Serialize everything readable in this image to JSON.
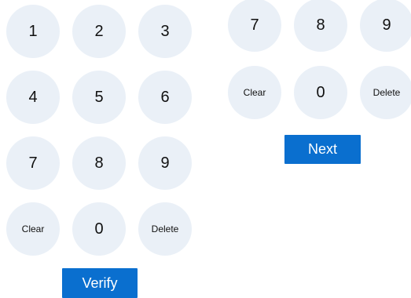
{
  "left_keypad": {
    "keys": [
      "1",
      "2",
      "3",
      "4",
      "5",
      "6",
      "7",
      "8",
      "9",
      "Clear",
      "0",
      "Delete"
    ],
    "action_label": "Verify"
  },
  "right_keypad": {
    "keys": [
      "7",
      "8",
      "9",
      "Clear",
      "0",
      "Delete"
    ],
    "action_label": "Next"
  },
  "colors": {
    "key_background": "#eaf0f7",
    "action_button": "#0a6fcf",
    "action_text": "#ffffff"
  }
}
